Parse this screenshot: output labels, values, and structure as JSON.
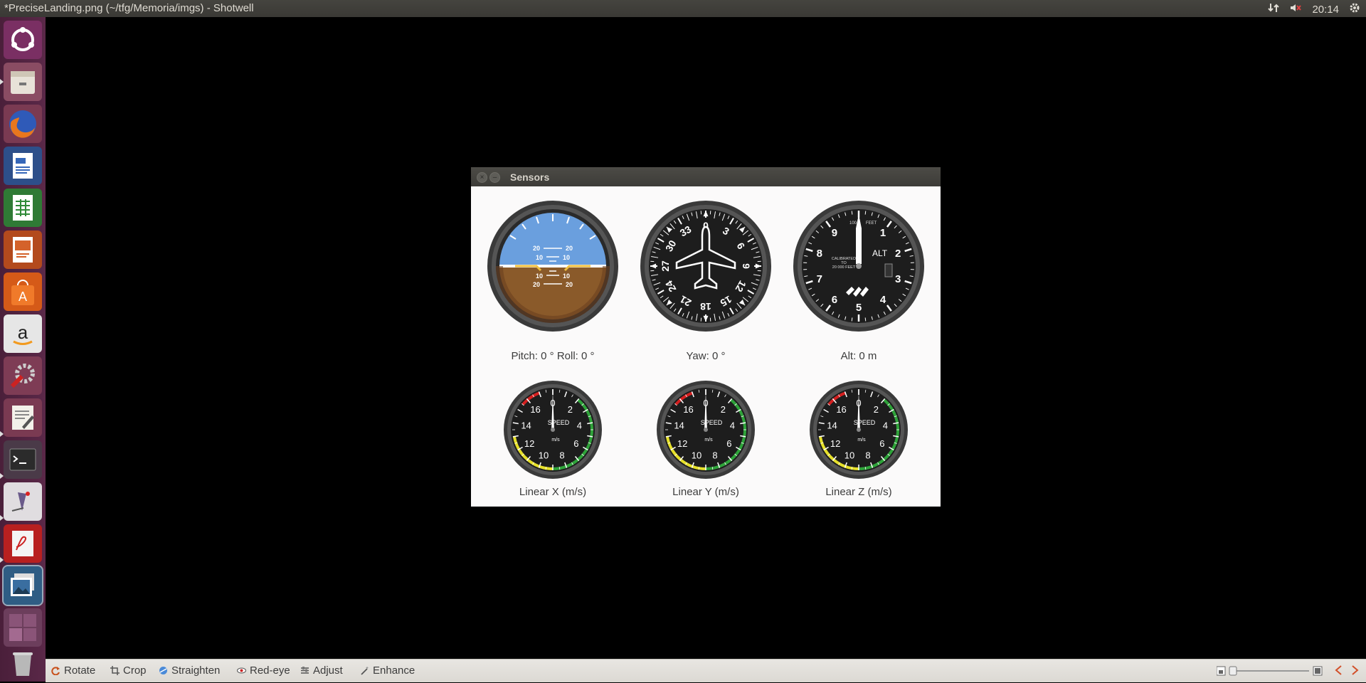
{
  "top_panel": {
    "window_title": "*PreciseLanding.png (~/tfg/Memoria/imgs) - Shotwell",
    "clock": "20:14"
  },
  "launcher": {
    "items": [
      "ubuntu-dash-icon",
      "files-icon",
      "firefox-icon",
      "writer-icon",
      "calc-icon",
      "impress-icon",
      "software-center-icon",
      "amazon-icon",
      "system-settings-icon",
      "text-editor-icon",
      "terminal-icon",
      "gimp-icon",
      "pdf-reader-icon",
      "shotwell-icon",
      "workspace-switcher-icon",
      "trash-icon"
    ]
  },
  "sensors_window": {
    "title": "Sensors",
    "pitch_label": "Pitch:",
    "pitch_value": "0 °",
    "roll_label": "Roll:",
    "roll_value": "0 °",
    "yaw_label": "Yaw:",
    "yaw_value": "0 °",
    "alt_label": "Alt:",
    "alt_value": "0 m",
    "linear_x_label": "Linear X (m/s)",
    "linear_y_label": "Linear Y (m/s)",
    "linear_z_label": "Linear Z (m/s)",
    "horizon_ticks": [
      "20",
      "20",
      "10",
      "10",
      "10",
      "10",
      "20",
      "20"
    ],
    "heading_ticks": [
      "0",
      "3",
      "6",
      "9",
      "12",
      "15",
      "18",
      "21",
      "24",
      "27",
      "30",
      "33"
    ],
    "altimeter_ticks": [
      "0",
      "1",
      "2",
      "3",
      "4",
      "5",
      "6",
      "7",
      "8",
      "9"
    ],
    "altimeter_text": "ALT",
    "altimeter_small": [
      "100",
      "FEET",
      "CALIBRATED",
      "TO",
      "20 000 FEET"
    ],
    "speed_ticks": [
      "0",
      "2",
      "4",
      "6",
      "8",
      "10",
      "12",
      "14",
      "16"
    ],
    "speed_text": "SPEED",
    "speed_unit": "m/s"
  },
  "toolbar": {
    "rotate": "Rotate",
    "crop": "Crop",
    "straighten": "Straighten",
    "redeye": "Red-eye",
    "adjust": "Adjust",
    "enhance": "Enhance"
  },
  "colors": {
    "sky": "#6a9fde",
    "ground": "#8a5a2a",
    "launcher_bg": "#4a1f3a",
    "panel_bg": "#3d3c38"
  }
}
